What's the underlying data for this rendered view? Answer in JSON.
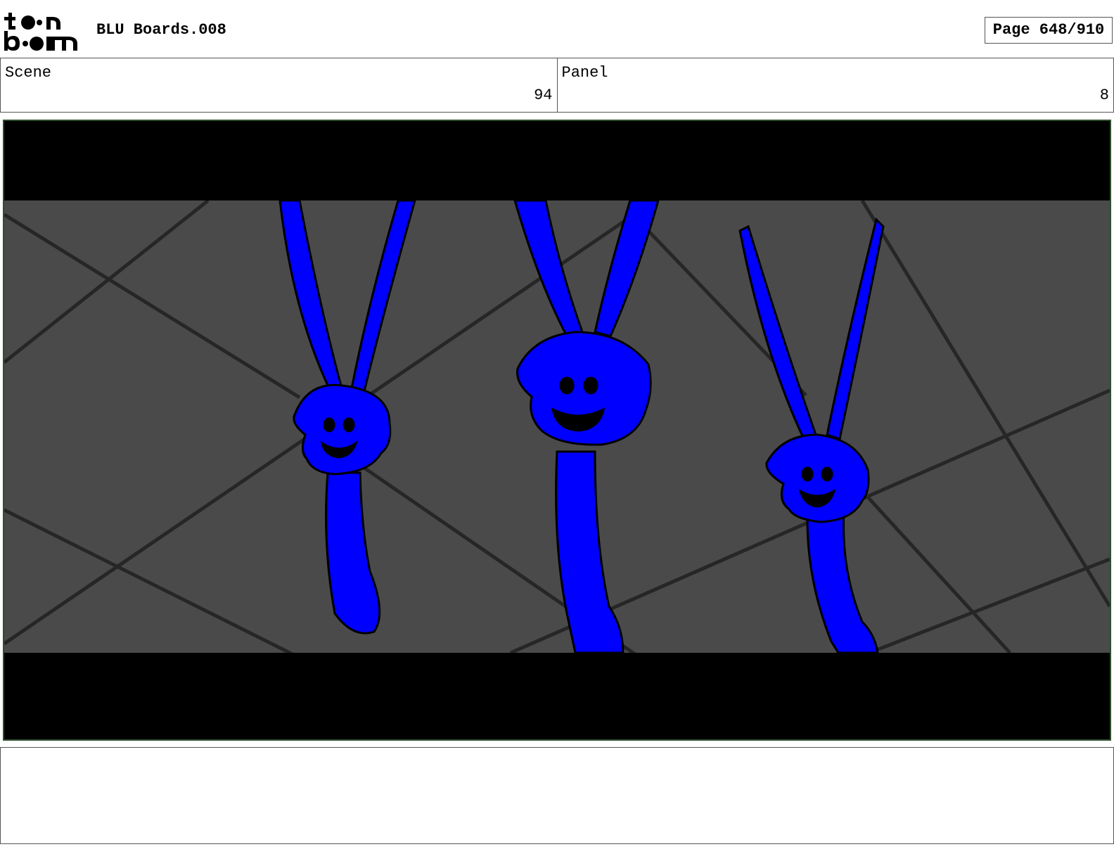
{
  "header": {
    "logo_text": "toon boom",
    "title": "BLU Boards.008",
    "page": "Page 648/910"
  },
  "info": {
    "scene_label": "Scene",
    "scene_value": "94",
    "panel_label": "Panel",
    "panel_value": "8"
  },
  "colors": {
    "character_fill": "#0000ff",
    "background_gray": "#4a4a4a",
    "letterbox": "#000000",
    "frame_border": "#2f4f2f"
  },
  "notes": {
    "text": ""
  }
}
